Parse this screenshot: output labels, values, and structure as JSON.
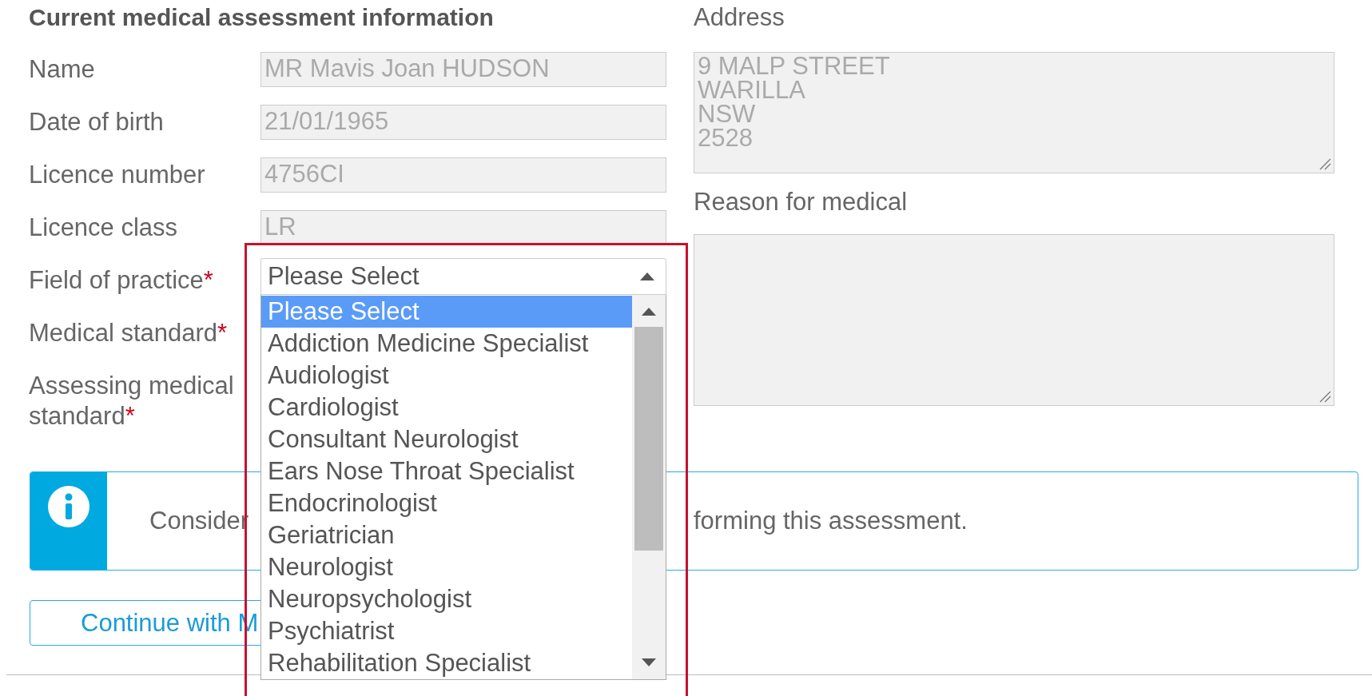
{
  "title": "Current medical assessment information",
  "fields": [
    {
      "label": "Name",
      "value": "MR Mavis Joan HUDSON",
      "kind": "readonly",
      "disabled": true
    },
    {
      "label": "Date of birth",
      "value": "21/01/1965",
      "kind": "readonly",
      "disabled": true
    },
    {
      "label": "Licence number",
      "value": "4756CI",
      "kind": "readonly",
      "disabled": true
    },
    {
      "label": "Licence class",
      "value": "LR",
      "kind": "readonly",
      "disabled": true
    },
    {
      "label": "Field of practice",
      "required_mark": "*",
      "kind": "dropdown"
    },
    {
      "label": "Medical standard",
      "required_mark": "*",
      "kind": "hidden"
    },
    {
      "label": "Assessing medical standard",
      "required_mark": "*",
      "kind": "hidden"
    }
  ],
  "address": {
    "label": "Address",
    "lines": [
      "9 MALP STREET",
      "WARILLA",
      "NSW",
      "2528"
    ]
  },
  "reason": {
    "label": "Reason for medical"
  },
  "info": {
    "text_parts": [
      "Consider",
      "forming this assessment."
    ]
  },
  "continue_button": {
    "label": "Continue with M"
  },
  "dropdown": {
    "highlighted": true,
    "value": "Please Select",
    "options": [
      {
        "label": "Please Select",
        "selected": true
      },
      {
        "label": "Addiction Medicine Specialist",
        "selected": false
      },
      {
        "label": "Audiologist",
        "selected": false
      },
      {
        "label": "Cardiologist",
        "selected": false
      },
      {
        "label": "Consultant Neurologist",
        "selected": false
      },
      {
        "label": "Ears Nose Throat Specialist",
        "selected": false
      },
      {
        "label": "Endocrinologist",
        "selected": false
      },
      {
        "label": "Geriatrician",
        "selected": false
      },
      {
        "label": "Neurologist",
        "selected": false
      },
      {
        "label": "Neuropsychologist",
        "selected": false
      },
      {
        "label": "Psychiatrist",
        "selected": false
      },
      {
        "label": "Rehabilitation Specialist",
        "selected": false
      }
    ]
  }
}
